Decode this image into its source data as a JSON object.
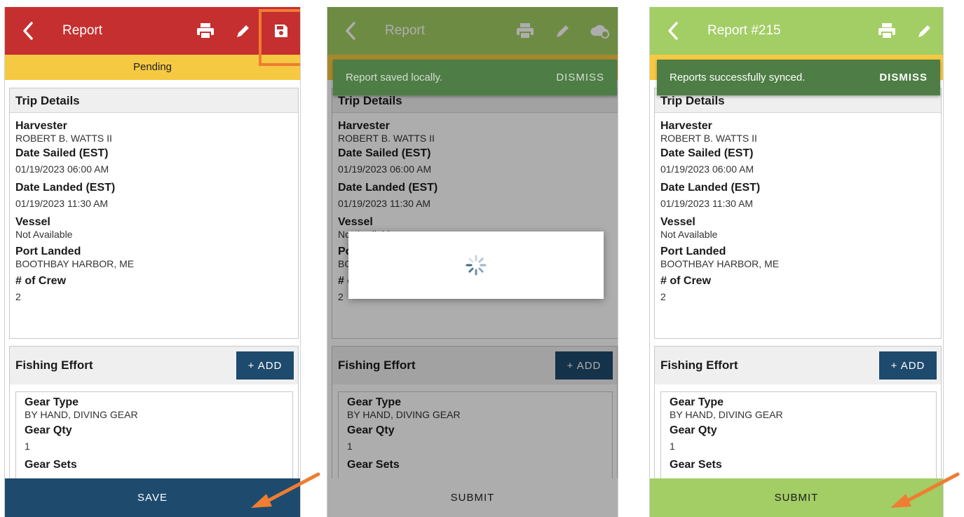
{
  "colors": {
    "pending_bar": "#c62f2f",
    "synced_bar": "#a3cd65",
    "status_yellow": "#f6c942",
    "save_button": "#1e4a6d",
    "add_button": "#1e4a6d",
    "snackbar": "#4e7d45",
    "annotation": "#ef7d32"
  },
  "icons": {
    "back": "chevron-left-icon",
    "print": "print-icon",
    "edit": "pencil-icon",
    "save": "floppy-disk-icon",
    "cloud_sync": "cloud-sync-icon",
    "spinner": "loading-spinner-icon"
  },
  "panels": [
    {
      "title": "Report",
      "status": "Pending",
      "bottom_button": "SAVE"
    },
    {
      "title": "Report",
      "snackbar": {
        "message": "Report saved locally.",
        "action": "DISMISS"
      },
      "bottom_button": "SUBMIT"
    },
    {
      "title": "Report #215",
      "snackbar": {
        "message": "Reports successfully synced.",
        "action": "DISMISS"
      },
      "bottom_button": "SUBMIT"
    }
  ],
  "trip_details": {
    "heading": "Trip Details",
    "fields": [
      {
        "label": "Harvester",
        "value": "ROBERT B. WATTS II"
      },
      {
        "label": "Date Sailed (EST)",
        "value": "01/19/2023 06:00 AM"
      },
      {
        "label": "Date Landed (EST)",
        "value": "01/19/2023 11:30 AM"
      },
      {
        "label": "Vessel",
        "value": "Not Available"
      },
      {
        "label": "Port Landed",
        "value": "BOOTHBAY HARBOR, ME"
      },
      {
        "label": "# of Crew",
        "value": "2"
      }
    ]
  },
  "fishing_effort": {
    "heading": "Fishing Effort",
    "add_label": "+ ADD",
    "fields": [
      {
        "label": "Gear Type",
        "value": "BY HAND, DIVING GEAR"
      },
      {
        "label": "Gear Qty",
        "value": "1"
      },
      {
        "label": "Gear Sets",
        "value": ""
      }
    ]
  }
}
